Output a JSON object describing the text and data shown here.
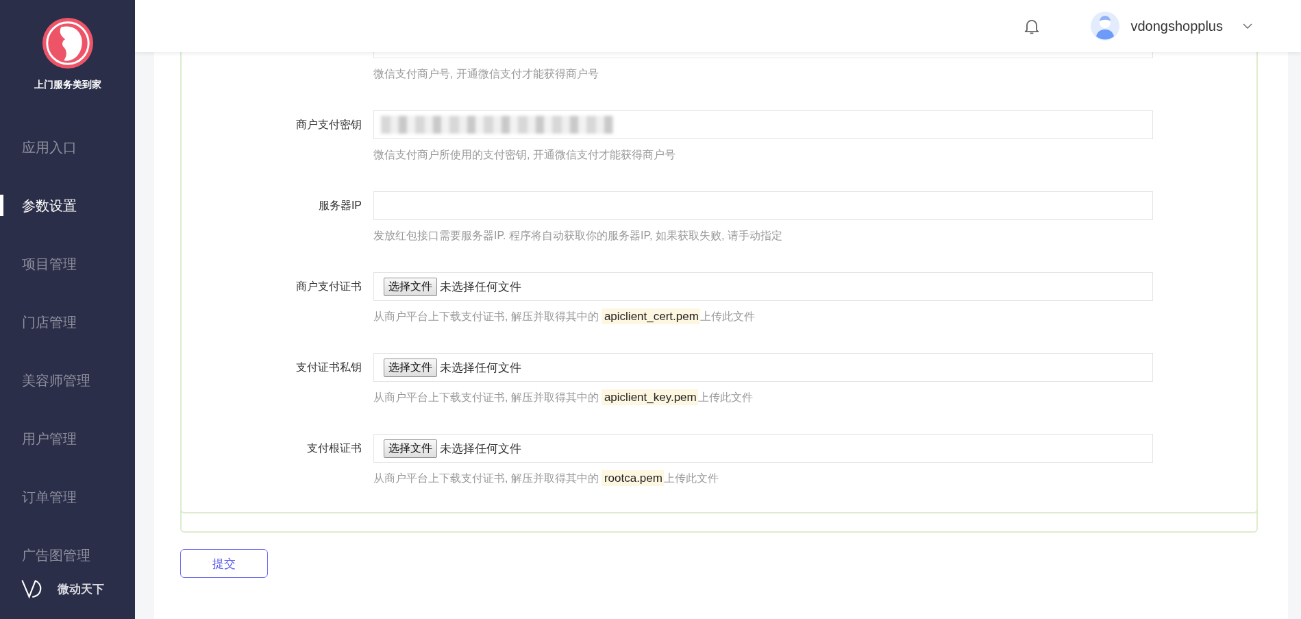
{
  "sidebar": {
    "brand": "上门服务美到家",
    "items": [
      {
        "label": "应用入口",
        "selected": false
      },
      {
        "label": "参数设置",
        "selected": true
      },
      {
        "label": "项目管理",
        "selected": false
      },
      {
        "label": "门店管理",
        "selected": false
      },
      {
        "label": "美容师管理",
        "selected": false
      },
      {
        "label": "用户管理",
        "selected": false
      },
      {
        "label": "订单管理",
        "selected": false
      },
      {
        "label": "广告图管理",
        "selected": false
      }
    ],
    "footer": "微动天下"
  },
  "header": {
    "username": "vdongshopplus"
  },
  "form": {
    "fields": [
      {
        "kind": "text",
        "redacted": false,
        "hint": "微信支付商户号, 开通微信支付才能获得商户号"
      },
      {
        "kind": "text",
        "label": "商户支付密钥",
        "redacted": true,
        "hint": "微信支付商户所使用的支付密钥, 开通微信支付才能获得商户号"
      },
      {
        "kind": "text",
        "label": "服务器IP",
        "redacted": false,
        "hint": "发放红包接口需要服务器IP. 程序将自动获取你的服务器IP, 如果获取失败, 请手动指定"
      },
      {
        "kind": "file",
        "label": "商户支付证书",
        "button": "选择文件",
        "status": "未选择任何文件",
        "hint": "从商户平台上下载支付证书, 解压并取得其中的",
        "filename": "apiclient_cert.pem",
        "hint_end": "上传此文件"
      },
      {
        "kind": "file",
        "label": "支付证书私钥",
        "button": "选择文件",
        "status": "未选择任何文件",
        "hint": "从商户平台上下载支付证书, 解压并取得其中的",
        "filename": "apiclient_key.pem",
        "hint_end": "上传此文件"
      },
      {
        "kind": "file",
        "label": "支付根证书",
        "button": "选择文件",
        "status": "未选择任何文件",
        "hint": "从商户平台上下载支付证书, 解压并取得其中的",
        "filename": "rootca.pem",
        "hint_end": "上传此文件"
      }
    ],
    "submit": "提交"
  }
}
